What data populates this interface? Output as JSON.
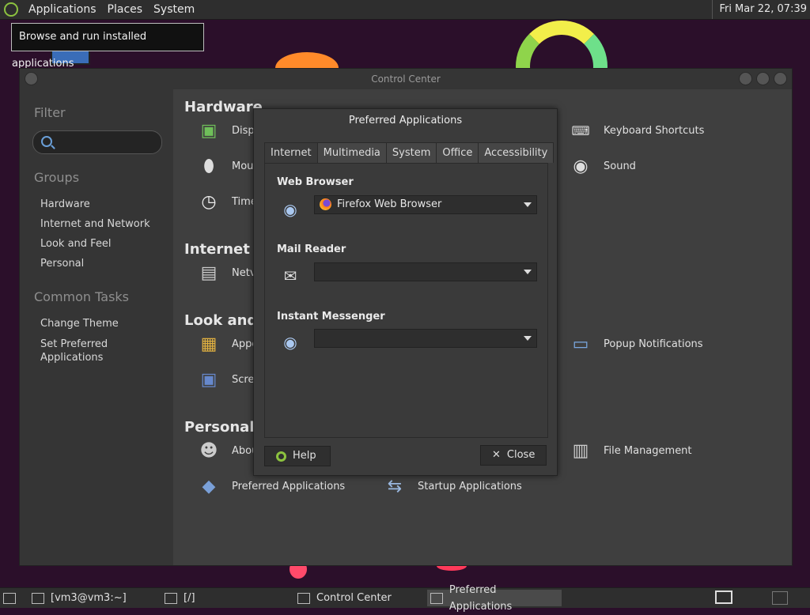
{
  "top_panel": {
    "menus": [
      "Applications",
      "Places",
      "System"
    ],
    "clock": "Fri Mar 22, 07:39"
  },
  "tooltip": "Browse and run installed applications",
  "control_center": {
    "title": "Control Center",
    "sidebar": {
      "filter_heading": "Filter",
      "groups_heading": "Groups",
      "groups": [
        "Hardware",
        "Internet and Network",
        "Look and Feel",
        "Personal"
      ],
      "tasks_heading": "Common Tasks",
      "tasks": [
        "Change Theme",
        "Set Preferred Applications"
      ]
    },
    "sections": {
      "hardware": "Hardware",
      "internet": "Internet ar",
      "look": "Look and F",
      "personal": "Personal"
    },
    "items": {
      "display": "Disp",
      "mouse": "Mou",
      "time": "Time",
      "network": "Netv",
      "appearance": "Appe",
      "screensaver": "Scre",
      "about_me": "Abou",
      "preferred_apps": "Preferred Applications",
      "startup_apps": "Startup Applications",
      "keyboard_shortcuts": "Keyboard Shortcuts",
      "sound": "Sound",
      "popup_notifications": "Popup Notifications",
      "file_management": "File Management"
    }
  },
  "dialog": {
    "title": "Preferred Applications",
    "tabs": [
      "Internet",
      "Multimedia",
      "System",
      "Office",
      "Accessibility"
    ],
    "active_tab": "Internet",
    "web_browser_label": "Web Browser",
    "web_browser_value": "Firefox Web Browser",
    "mail_reader_label": "Mail Reader",
    "mail_reader_value": "",
    "im_label": "Instant Messenger",
    "im_value": "",
    "help_button": "Help",
    "close_button": "Close"
  },
  "taskbar": {
    "tasks": [
      "[vm3@vm3:~]",
      "[/]",
      "Control Center",
      "Preferred Applications"
    ]
  }
}
